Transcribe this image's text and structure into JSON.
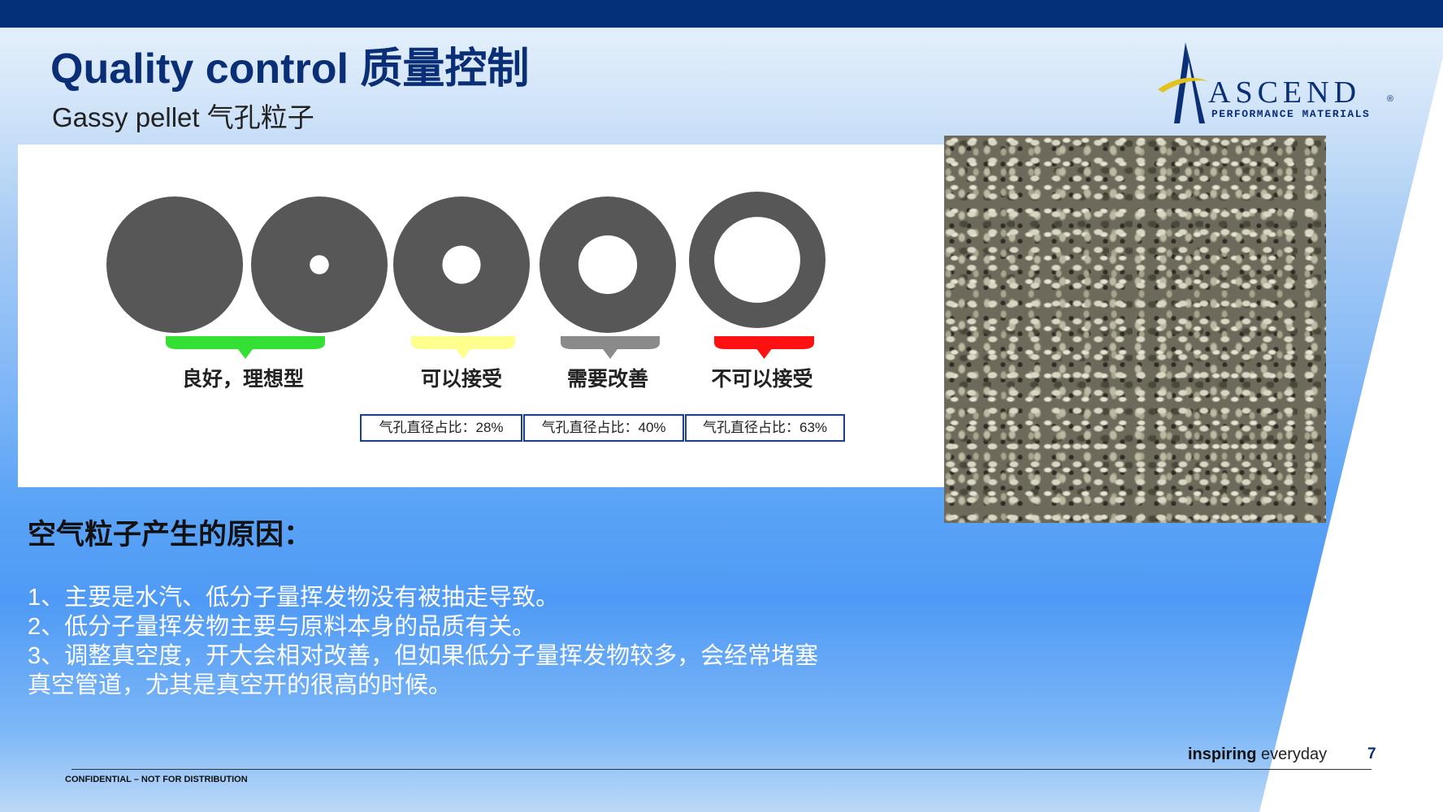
{
  "title": "Quality control 质量控制",
  "subtitle": "Gassy pellet   气孔粒子",
  "logo": {
    "word": "ASCEND",
    "reg": "®",
    "tagline": "PERFORMANCE MATERIALS",
    "colors": {
      "navy": "#0a2f77",
      "gold": "#e4c21c"
    }
  },
  "diagram": {
    "pellets": [
      {
        "hole_ratio": 0
      },
      {
        "hole_ratio": 0.14
      },
      {
        "hole_ratio": 0.28
      },
      {
        "hole_ratio": 0.43
      },
      {
        "hole_ratio": 0.63
      }
    ],
    "labels": [
      "良好，理想型",
      "可以接受",
      "需要改善",
      "不可以接受"
    ],
    "label_colors": [
      "#35e035",
      "#ffff8e",
      "#8a8a8a",
      "#ff1111"
    ],
    "ratio_boxes": [
      "气孔直径占比：28%",
      "气孔直径占比：40%",
      "气孔直径占比：63%"
    ]
  },
  "photo": {
    "icon": "plastic-pellets-photo"
  },
  "reasons": {
    "title": "空气粒子产生的原因：",
    "items": [
      "1、主要是水汽、低分子量挥发物没有被抽走导致。",
      "2、低分子量挥发物主要与原料本身的品质有关。",
      "3、调整真空度，开大会相对改善，但如果低分子量挥发物较多，会经常堵塞",
      "真空管道，尤其是真空开的很高的时候。"
    ]
  },
  "footer": {
    "tagline_bold": "inspiring",
    "tagline_rest": " everyday",
    "page": "7",
    "confidential": "CONFIDENTIAL – NOT FOR DISTRIBUTION"
  }
}
